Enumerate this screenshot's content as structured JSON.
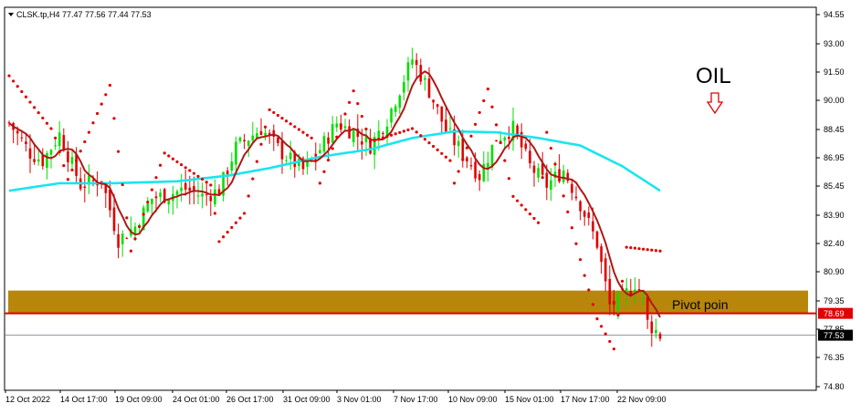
{
  "header": {
    "symbol_line": "CLSK.tp,H4  77.47 77.56 77.44 77.53"
  },
  "annotations": {
    "oil_label": "OIL",
    "arrow_icon": "down-outline-arrow-icon",
    "pivot_label": "Pivot poin"
  },
  "colors": {
    "bull": "#00e000",
    "bear": "#e00000",
    "ma_short": "#b01818",
    "ma_long": "#19e5ee",
    "sar": "#e00000",
    "zone": "#b8860b",
    "pivot_line": "#e00000",
    "price_line": "#6a7a8a"
  },
  "chart_data": {
    "type": "candlestick",
    "y_ticks": [
      "94.55",
      "93.00",
      "91.50",
      "90.00",
      "88.45",
      "86.95",
      "85.45",
      "83.90",
      "82.40",
      "80.90",
      "79.35",
      "77.85",
      "76.35",
      "74.80"
    ],
    "ylim": [
      74.8,
      94.55
    ],
    "x_ticks": [
      "12 Oct 2022",
      "14 Oct 17:00",
      "19 Oct 09:00",
      "24 Oct 01:00",
      "26 Oct 17:00",
      "31 Oct 09:00",
      "3 Nov 01:00",
      "7 Nov 17:00",
      "10 Nov 09:00",
      "15 Nov 01:00",
      "17 Nov 17:00",
      "22 Nov 09:00"
    ],
    "pivot_value": 78.69,
    "pivot_label": "78.69",
    "last_price": 77.53,
    "last_price_label": "77.53",
    "zone": [
      78.69,
      79.9
    ],
    "ma_long_anchors": [
      [
        0,
        85.2
      ],
      [
        12,
        85.6
      ],
      [
        25,
        85.6
      ],
      [
        40,
        85.7
      ],
      [
        52,
        86.0
      ],
      [
        62,
        86.4
      ],
      [
        74,
        87.0
      ],
      [
        86,
        87.4
      ],
      [
        96,
        88.0
      ],
      [
        106,
        88.35
      ],
      [
        116,
        88.3
      ],
      [
        126,
        88.0
      ],
      [
        136,
        87.6
      ],
      [
        146,
        86.5
      ],
      [
        155,
        85.2
      ]
    ],
    "close_anchors": [
      [
        0,
        88.8
      ],
      [
        5,
        87.2
      ],
      [
        8,
        86.8
      ],
      [
        12,
        88.2
      ],
      [
        17,
        85.5
      ],
      [
        22,
        85.8
      ],
      [
        26,
        82.6
      ],
      [
        30,
        83.3
      ],
      [
        34,
        84.8
      ],
      [
        38,
        85.0
      ],
      [
        42,
        85.3
      ],
      [
        46,
        84.9
      ],
      [
        50,
        85.2
      ],
      [
        54,
        87.5
      ],
      [
        60,
        88.5
      ],
      [
        65,
        87.2
      ],
      [
        70,
        86.3
      ],
      [
        74,
        87.4
      ],
      [
        78,
        88.8
      ],
      [
        82,
        88.3
      ],
      [
        86,
        87.6
      ],
      [
        90,
        89.0
      ],
      [
        96,
        92.2
      ],
      [
        100,
        90.5
      ],
      [
        104,
        88.4
      ],
      [
        108,
        87.2
      ],
      [
        112,
        86.0
      ],
      [
        116,
        88.0
      ],
      [
        120,
        88.5
      ],
      [
        124,
        86.5
      ],
      [
        128,
        85.5
      ],
      [
        132,
        86.3
      ],
      [
        136,
        84.5
      ],
      [
        140,
        82.4
      ],
      [
        143,
        79.1
      ],
      [
        146,
        79.5
      ],
      [
        149,
        80.3
      ],
      [
        151,
        79.6
      ],
      [
        152,
        78.2
      ],
      [
        155,
        77.53
      ]
    ],
    "sar_anchors": [
      [
        0,
        91.3
      ],
      [
        10,
        88.5
      ],
      [
        11,
        88.0
      ],
      [
        14,
        85.8
      ],
      [
        24,
        90.8
      ],
      [
        29,
        82.0
      ],
      [
        37,
        87.2
      ],
      [
        48,
        85.5
      ],
      [
        50,
        82.5
      ],
      [
        56,
        84.0
      ],
      [
        62,
        89.5
      ],
      [
        72,
        88.0
      ],
      [
        74,
        85.6
      ],
      [
        82,
        90.5
      ],
      [
        86,
        87.8
      ],
      [
        96,
        88.5
      ],
      [
        105,
        86.8
      ],
      [
        106,
        85.6
      ],
      [
        114,
        90.6
      ],
      [
        120,
        84.9
      ],
      [
        126,
        83.5
      ],
      [
        128,
        88.3
      ],
      [
        137,
        80.7
      ],
      [
        140,
        78.4
      ],
      [
        144,
        76.8
      ],
      [
        147,
        82.2
      ],
      [
        155,
        82.0
      ]
    ]
  }
}
